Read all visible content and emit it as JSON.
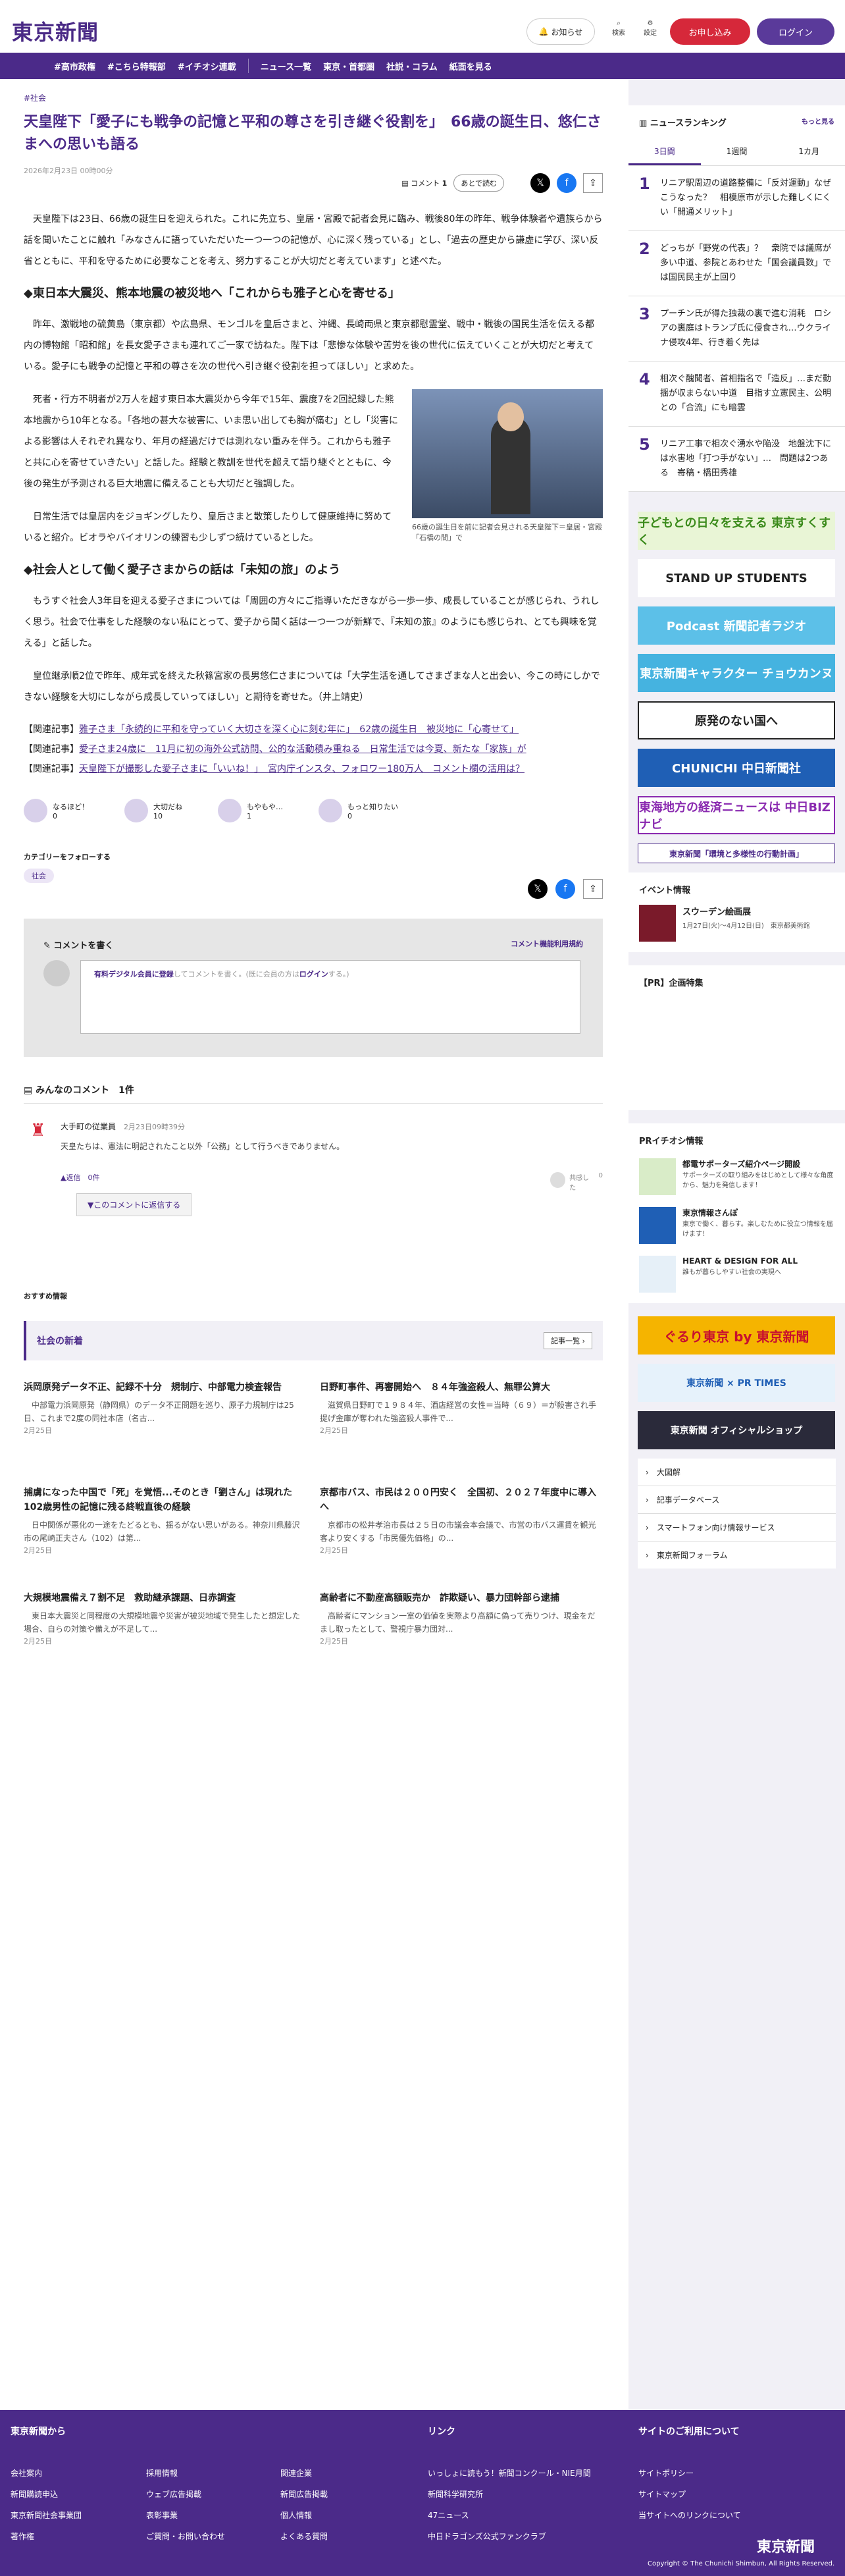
{
  "header": {
    "logo": "東京新聞",
    "notice": "お知らせ",
    "search": "検索",
    "settings": "設定",
    "subscribe": "お申し込み",
    "login": "ログイン"
  },
  "nav": [
    "#高市政権",
    "#こちら特報部",
    "#イチオシ連載",
    "ニュース一覧",
    "東京・首都圏",
    "社説・コラム",
    "紙面を見る"
  ],
  "article": {
    "tag": "#社会",
    "title": "天皇陛下「愛子にも戦争の記憶と平和の尊さを引き継ぐ役割を」　66歳の誕生日、悠仁さまへの思いも語る",
    "date": "2026年2月23日 00時00分",
    "comment_label": "コメント",
    "comment_count": "1",
    "later": "あとで読む",
    "p1": "天皇陛下は23日、66歳の誕生日を迎えられた。これに先立ち、皇居・宮殿で記者会見に臨み、戦後80年の昨年、戦争体験者や遺族らから話を聞いたことに触れ「みなさんに語っていただいた一つ一つの記憶が、心に深く残っている」とし、「過去の歴史から謙虚に学び、深い反省とともに、平和を守るために必要なことを考え、努力することが大切だと考えています」と述べた。",
    "h1": "◆東日本大震災、熊本地震の被災地へ「これからも雅子と心を寄せる」",
    "p2": "昨年、激戦地の硫黄島（東京都）や広島県、モンゴルを皇后さまと、沖縄、長崎両県と東京都慰霊堂、戦中・戦後の国民生活を伝える都内の博物館「昭和館」を長女愛子さまも連れてご一家で訪ねた。陛下は「悲惨な体験や苦労を後の世代に伝えていくことが大切だと考えている。愛子にも戦争の記憶と平和の尊さを次の世代へ引き継ぐ役割を担ってほしい」と求めた。",
    "p3": "死者・行方不明者が2万人を超す東日本大震災から今年で15年、震度7を2回記録した熊本地震から10年となる。「各地の甚大な被害に、いま思い出しても胸が痛む」とし「災害による影響は人それぞれ異なり、年月の経過だけでは測れない重みを伴う。これからも雅子と共に心を寄せていきたい」と話した。経験と教訓を世代を超えて語り継ぐとともに、今後の発生が予測される巨大地震に備えることも大切だと強調した。",
    "p4": "日常生活では皇居内をジョギングしたり、皇后さまと散策したりして健康維持に努めていると紹介。ビオラやバイオリンの練習も少しずつ続けているとした。",
    "h2": "◆社会人として働く愛子さまからの話は「未知の旅」のよう",
    "p5": "もうすぐ社会人3年目を迎える愛子さまについては「周囲の方々にご指導いただきながら一歩一歩、成長していることが感じられ、うれしく思う。社会で仕事をした経験のない私にとって、愛子から聞く話は一つ一つが新鮮で、『未知の旅』のようにも感じられ、とても興味を覚える」と話した。",
    "p6": "皇位継承順2位で昨年、成年式を終えた秋篠宮家の長男悠仁さまについては「大学生活を通してさまざまな人と出会い、今この時にしかできない経験を大切にしながら成長していってほしい」と期待を寄せた。（井上靖史）",
    "fig_caption": "66歳の誕生日を前に記者会見される天皇陛下＝皇居・宮殿「石橋の間」で",
    "related": [
      {
        "k": "【関連記事】",
        "t": "雅子さま「永続的に平和を守っていく大切さを深く心に刻む年に」　62歳の誕生日　被災地に「心寄せて」"
      },
      {
        "k": "【関連記事】",
        "t": "愛子さま24歳に　11月に初の海外公式訪問、公的な活動積み重ねる　日常生活では今夏、新たな「家族」が"
      },
      {
        "k": "【関連記事】",
        "t": "天皇陛下が撮影した愛子さまに「いいね！」　宮内庁インスタ、フォロワー180万人　コメント欄の活用は？"
      }
    ],
    "reactions": [
      {
        "l": "なるほど！",
        "c": "0"
      },
      {
        "l": "大切だね",
        "c": "10"
      },
      {
        "l": "もやもや…",
        "c": "1"
      },
      {
        "l": "もっと知りたい",
        "c": "0"
      }
    ],
    "follow_label": "カテゴリーをフォローする",
    "follow_tag": "社会"
  },
  "comments": {
    "write": "コメントを書く",
    "rules": "コメント機能利用規約",
    "prompt_link": "有料デジタル会員に登録",
    "prompt_mid": "してコメントを書く。(既に会員の方は",
    "prompt_login": "ログイン",
    "prompt_end": "する。)",
    "list_title": "みんなのコメント",
    "list_count": "1件",
    "user": "大手町の従業員",
    "time": "2月23日09時39分",
    "text": "天皇たちは、憲法に明記されたこと以外「公務」として行うべきでありません。",
    "reply_count": "返信　0件",
    "reply_btn": "このコメントに返信する",
    "like": "共感した",
    "like_n": "0"
  },
  "recommend_label": "おすすめ情報",
  "social": {
    "title": "社会の新着",
    "more": "記事一覧",
    "items": [
      {
        "h": "浜岡原発データ不正、記録不十分　規制庁、中部電力検査報告",
        "p": "中部電力浜岡原発（静岡県）のデータ不正問題を巡り、原子力規制庁は25日、これまで2度の同社本店（名古...",
        "d": "2月25日"
      },
      {
        "h": "日野町事件、再審開始へ　８４年強盗殺人、無罪公算大",
        "p": "滋賀県日野町で１９８４年、酒店経営の女性＝当時（６９）＝が殺害され手提げ金庫が奪われた強盗殺人事件で...",
        "d": "2月25日"
      },
      {
        "h": "捕虜になった中国で「死」を覚悟...そのとき「劉さん」は現れた　102歳男性の記憶に残る終戦直後の経験",
        "p": "日中関係が悪化の一途をたどるとも、揺るがない思いがある。神奈川県藤沢市の尾崎正夫さん（102）は第...",
        "d": "2月25日"
      },
      {
        "h": "京都市バス、市民は２００円安く　全国初、２０２７年度中に導入へ",
        "p": "京都市の松井孝治市長は２５日の市議会本会議で、市営の市バス運賃を観光客より安くする「市民優先価格」の...",
        "d": "2月25日"
      },
      {
        "h": "大規模地震備え７割不足　救助継承課題、日赤調査",
        "p": "東日本大震災と同程度の大規模地震や災害が被災地域で発生したと想定した場合、自らの対策や備えが不足して...",
        "d": "2月25日"
      },
      {
        "h": "高齢者に不動産高額販売か　詐欺疑い、暴力団幹部ら逮捕",
        "p": "高齢者にマンション一室の価値を実際より高額に偽って売りつけ、現金をだまし取ったとして、警視庁暴力団対...",
        "d": "2月25日"
      }
    ]
  },
  "side": {
    "ranking": "ニュースランキング",
    "more": "もっと見る",
    "tabs": [
      "3日間",
      "1週間",
      "1カ月"
    ],
    "rank": [
      "リニア駅周辺の道路整備に「反対運動」なぜこうなった？　相模原市が示した難しくにくい「開通メリット」",
      "どっちが「野党の代表」？　衆院では議席が多い中道、参院とあわせた「国会議員数」では国民民主が上回り",
      "プーチン氏が得た独裁の裏で進む消耗　ロシアの裏庭はトランプ氏に侵食され…ウクライナ侵攻4年、行き着く先は",
      "相次ぐ醜聞者、首相指名で「造反」…まだ動揺が収まらない中道　目指す立憲民主、公明との「合流」にも暗雲",
      "リニア工事で相次ぐ湧水や陥没　地盤沈下には水害地「打つ手がない」…　問題は2つある　寄稿・橋田秀雄"
    ],
    "banners": [
      "子どもとの日々を支える 東京すくすく",
      "STAND UP STUDENTS",
      "Podcast 新聞記者ラジオ",
      "東京新聞キャラクター チョウカンヌ",
      "原発のない国へ",
      "CHUNICHI 中日新聞社",
      "東海地方の経済ニュースは 中日BIZナビ",
      "東京新聞「環境と多様性の行動計画」"
    ],
    "event_title": "イベント情報",
    "event_name": "スウーデン絵画展",
    "event_detail": "1月27日(火)〜4月12日(日)　東京都美術館",
    "pr_title": "【PR】企画特集",
    "pr_event": "PRイチオシ情報",
    "pr_items": [
      {
        "t": "都電サポーターズ紹介ページ開設",
        "d": "サポーターズの取り組みをはじめとして様々な角度から、魅力を発信します！"
      },
      {
        "t": "東京情報さんぽ",
        "d": "東京で働く、暮らす。楽しむために役立つ情報を届けます！"
      },
      {
        "t": "HEART & DESIGN FOR ALL",
        "d": "誰もが暮らしやすい社会の実現へ"
      }
    ],
    "banners2": [
      "ぐるり東京 by 東京新聞",
      "東京新聞 × PR TIMES",
      "東京新聞 オフィシャルショップ"
    ],
    "links": [
      "大図解",
      "記事データベース",
      "スマートフォン向け情報サービス",
      "東京新聞フォーラム"
    ]
  },
  "footer": {
    "h1": "東京新聞から",
    "h2": "リンク",
    "h3": "サイトのご利用について",
    "c1": [
      "会社案内",
      "新聞購読申込",
      "東京新聞社会事業団",
      "著作権"
    ],
    "c2": [
      "採用情報",
      "ウェブ広告掲載",
      "表彰事業",
      "ご質問・お問い合わせ"
    ],
    "c3": [
      "関連企業",
      "新聞広告掲載",
      "個人情報",
      "よくある質問"
    ],
    "c4": [
      "いっしょに読もう！新聞コンクール・NIE月間",
      "新聞科学研究所",
      "47ニュース",
      "中日ドラゴンズ公式ファンクラブ"
    ],
    "c5": [
      "サイトポリシー",
      "サイトマップ",
      "当サイトへのリンクについて"
    ],
    "logo": "東京新聞",
    "copy": "Copyright © The Chunichi Shimbun, All Rights Reserved."
  }
}
